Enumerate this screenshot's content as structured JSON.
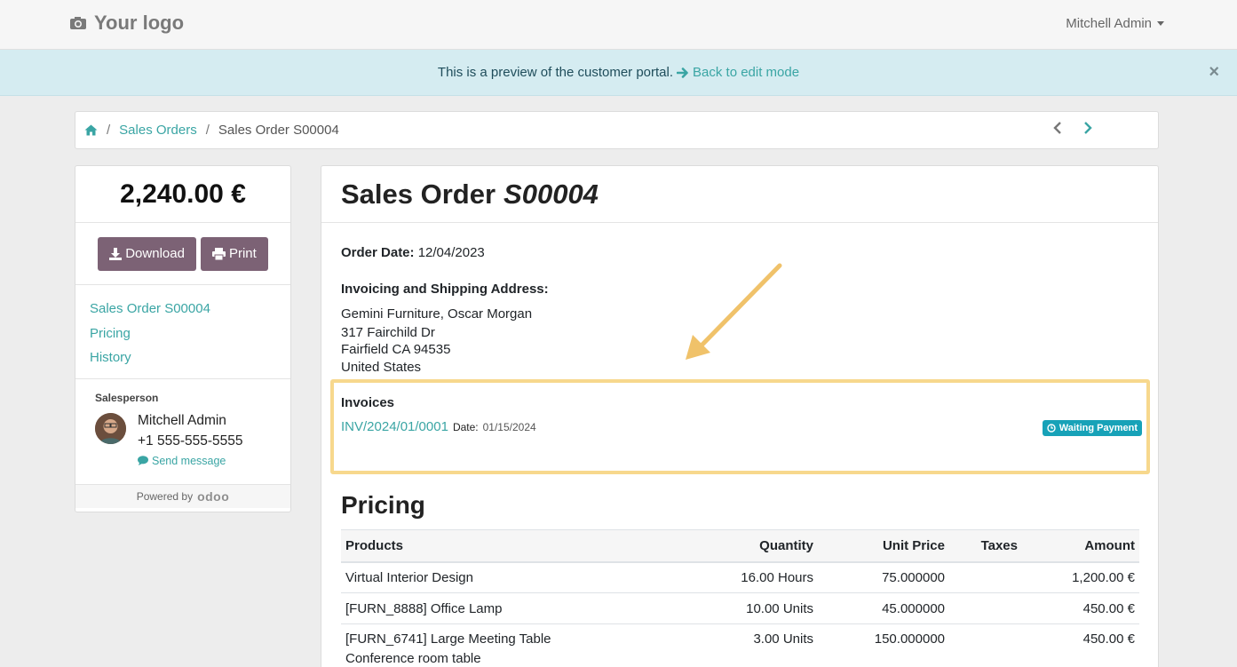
{
  "navbar": {
    "logo_text": "Your logo",
    "user_name": "Mitchell Admin"
  },
  "banner": {
    "message": "This is a preview of the customer portal.",
    "link": "Back to edit mode"
  },
  "breadcrumb": {
    "items": [
      "Sales Orders"
    ],
    "current": "Sales Order S00004"
  },
  "sidebar": {
    "amount": "2,240.00 €",
    "download_label": "Download",
    "print_label": "Print",
    "toc": [
      "Sales Order S00004",
      "Pricing",
      "History"
    ],
    "salesperson_label": "Salesperson",
    "salesperson_name": "Mitchell Admin",
    "salesperson_phone": "+1 555-555-5555",
    "send_message": "Send message",
    "powered_by": "Powered by",
    "powered_brand": "odoo"
  },
  "order": {
    "title_prefix": "Sales Order",
    "title_ref": "S00004",
    "order_date_label": "Order Date:",
    "order_date": "12/04/2023",
    "address_label": "Invoicing and Shipping Address:",
    "address_lines": [
      "Gemini Furniture, Oscar Morgan",
      "317 Fairchild Dr",
      "Fairfield CA 94535",
      "United States"
    ],
    "invoices_label": "Invoices",
    "invoice_number": "INV/2024/01/0001",
    "invoice_date_label": "Date:",
    "invoice_date": "01/15/2024",
    "invoice_status": "Waiting Payment"
  },
  "pricing": {
    "title": "Pricing",
    "columns": [
      "Products",
      "Quantity",
      "Unit Price",
      "Taxes",
      "Amount"
    ],
    "rows": [
      {
        "product": "Virtual Interior Design",
        "description": "",
        "quantity": "16.00 Hours",
        "unit_price": "75.000000",
        "taxes": "",
        "amount": "1,200.00 €"
      },
      {
        "product": "[FURN_8888] Office Lamp",
        "description": "",
        "quantity": "10.00 Units",
        "unit_price": "45.000000",
        "taxes": "",
        "amount": "450.00 €"
      },
      {
        "product": "[FURN_6741] Large Meeting Table",
        "description": "Conference room table",
        "quantity": "3.00 Units",
        "unit_price": "150.000000",
        "taxes": "",
        "amount": "450.00 €"
      }
    ]
  },
  "colors": {
    "accent": "#3aa5a4",
    "button": "#7c6275",
    "highlight": "#f7d88d",
    "badge": "#17a2b8",
    "banner": "#d5ecf1"
  }
}
